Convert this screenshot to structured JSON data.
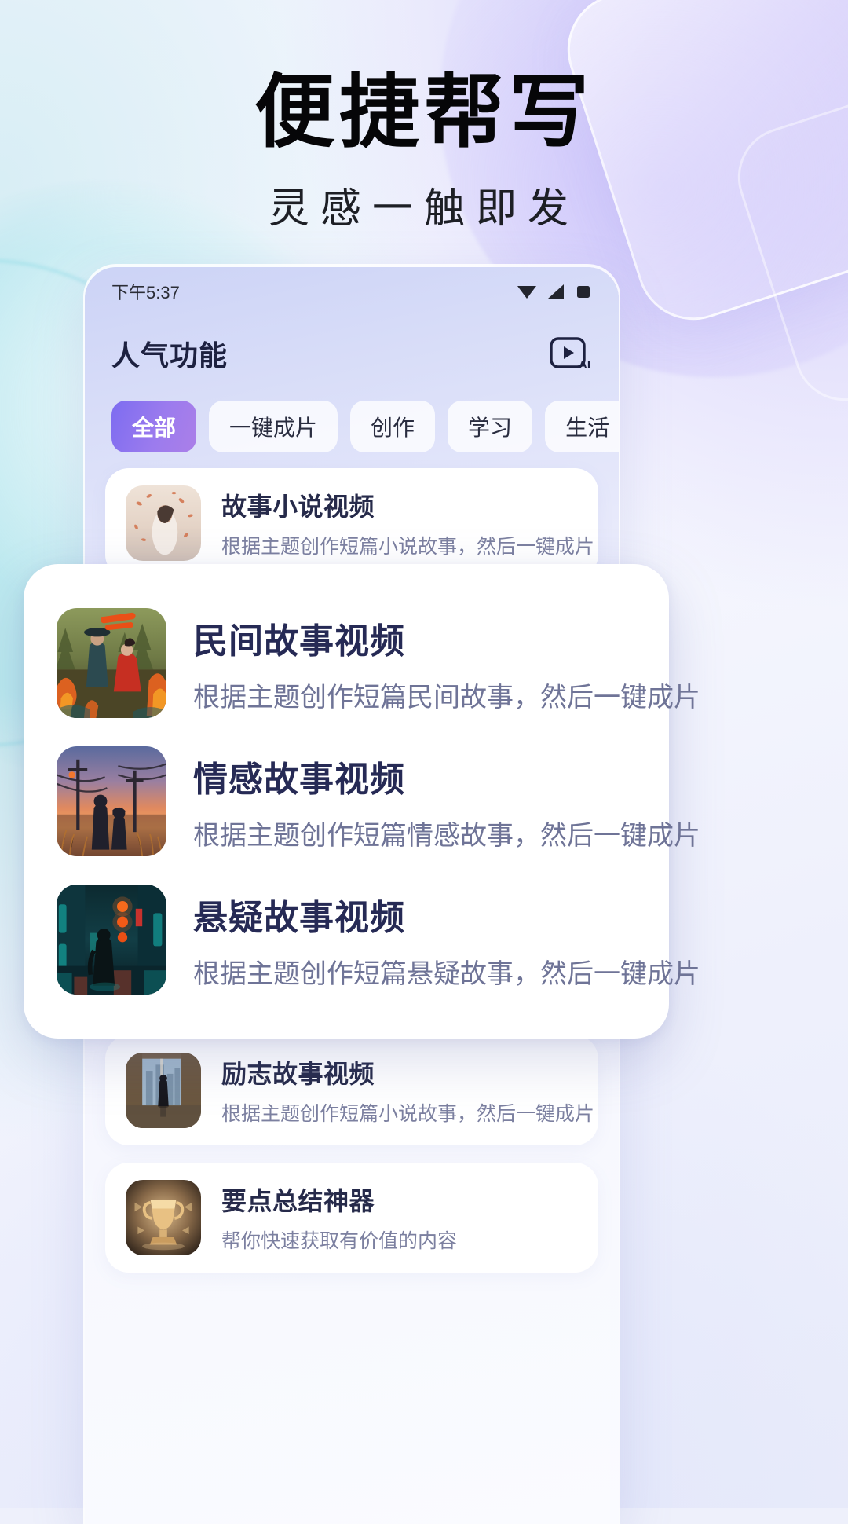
{
  "hero": {
    "title": "便捷帮写",
    "subtitle": "灵感一触即发"
  },
  "colors": {
    "accent_start": "#7d6cf0",
    "accent_end": "#ab7fe8",
    "title_text": "#1d2140",
    "card_title": "#262a4a",
    "card_desc": "#7c80a0",
    "popup_bg": "#ffffff"
  },
  "phone": {
    "statusbar": {
      "time": "下午5:37",
      "icons": [
        "wifi-icon",
        "signal-icon",
        "battery-icon"
      ]
    },
    "header": {
      "title": "人气功能",
      "action_icon": "ai-video-icon"
    },
    "tabs": [
      {
        "label": "全部",
        "active": true
      },
      {
        "label": "一键成片",
        "active": false
      },
      {
        "label": "创作",
        "active": false
      },
      {
        "label": "学习",
        "active": false
      },
      {
        "label": "生活",
        "active": false
      }
    ],
    "list": [
      {
        "title": "故事小说视频",
        "desc": "根据主题创作短篇小说故事，然后一键成片",
        "thumb": "woman-petals-thumb"
      },
      {
        "title": "励志故事视频",
        "desc": "根据主题创作短篇小说故事，然后一键成片",
        "thumb": "man-window-city-thumb"
      },
      {
        "title": "要点总结神器",
        "desc": "帮你快速获取有价值的内容",
        "thumb": "golden-trophy-thumb"
      }
    ]
  },
  "popup": {
    "items": [
      {
        "title": "民间故事视频",
        "desc": "根据主题创作短篇民间故事，然后一键成片",
        "thumb": "folk-tale-forest-thumb"
      },
      {
        "title": "情感故事视频",
        "desc": "根据主题创作短篇情感故事，然后一键成片",
        "thumb": "sunset-couple-thumb"
      },
      {
        "title": "悬疑故事视频",
        "desc": "根据主题创作短篇悬疑故事，然后一键成片",
        "thumb": "neon-alley-thumb"
      }
    ]
  }
}
